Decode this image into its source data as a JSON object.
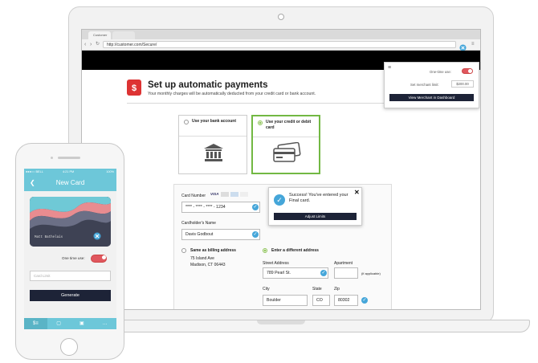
{
  "browser": {
    "tabs": [
      "Customer",
      ""
    ],
    "url": "http://customer.com/Secure/"
  },
  "page": {
    "title": "Set up automatic payments",
    "subtitle": "Your monthly charges will be automatically deducted from your credit card or bank account.",
    "calendar_glyph": "$",
    "options": [
      {
        "label": "Use your bank account",
        "selected": false
      },
      {
        "label": "Use your credit or debit card",
        "selected": true
      }
    ]
  },
  "form": {
    "card_number_label": "Card Number",
    "card_brands": [
      "VISA",
      "MC",
      "AMEX",
      "DISC"
    ],
    "card_number_value": "**** - **** - **** - 1234",
    "cardholder_label": "Cardholder's Name",
    "cardholder_value": "Davis Godbout",
    "same_billing_label": "Same as billing address",
    "billing_line1": "75 Island Ave",
    "billing_line2": "Madison, CT 06443",
    "different_address_label": "Enter a different address",
    "street_label": "Street Address",
    "street_value": "789 Pearl St.",
    "apartment_label": "Apartment",
    "apartment_note": "(if applicable)",
    "city_label": "City",
    "city_value": "Boulder",
    "state_label": "State",
    "state_value": "CO",
    "zip_label": "Zip",
    "zip_value": "80302"
  },
  "success_popup": {
    "message": "Success! You've entered your Final card.",
    "button": "Adjust Limits",
    "close": "✕"
  },
  "dashboard_popup": {
    "one_time_label": "One-time use:",
    "one_time_on": true,
    "limit_label": "Set merchant limit:",
    "limit_value": "$200.00",
    "button": "View Merchant in Dashboard"
  },
  "phone": {
    "status_left": "●●●○○ BELL",
    "status_time": "4:21 PM",
    "status_right": "100%",
    "header_title": "New Card",
    "back_glyph": "❮",
    "card_name": "Matt Bathelais",
    "one_time_label": "One time use:",
    "one_time_on": true,
    "card_limit_placeholder": "Card Limit",
    "generate_button": "Generate",
    "tabs": [
      "$≡",
      "▢",
      "▣",
      "…"
    ]
  },
  "colors": {
    "accent_green": "#72b843",
    "accent_blue": "#45a6d9",
    "teal": "#6dc7d9",
    "dark_button": "#1d2337",
    "toggle_red": "#e0575e"
  }
}
